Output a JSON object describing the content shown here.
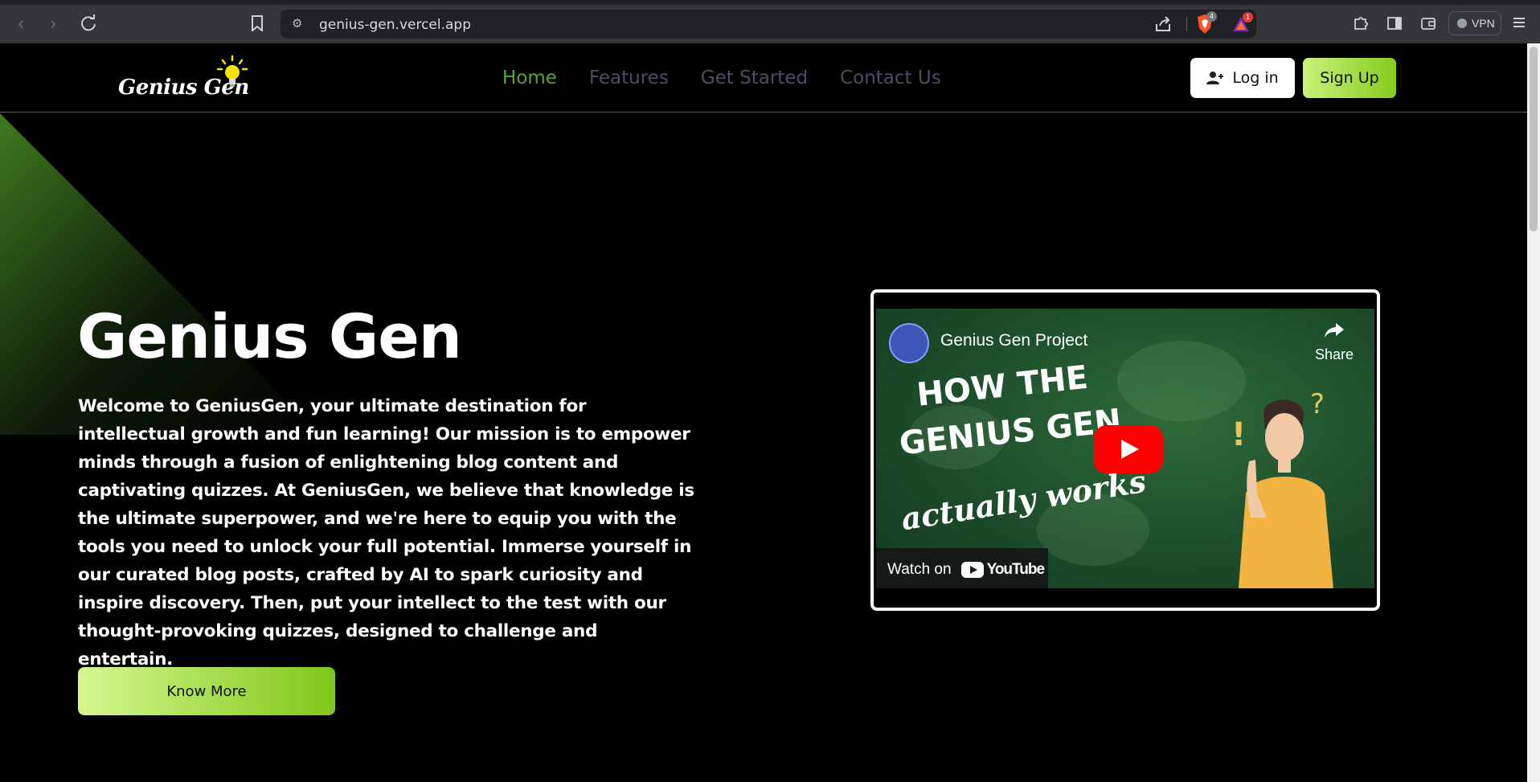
{
  "browser": {
    "url": "genius-gen.vercel.app",
    "brave_badge": "4",
    "alert_badge": "1",
    "vpn_label": "VPN"
  },
  "nav": {
    "logo_text": "Genius Gen",
    "links": [
      {
        "label": "Home",
        "active": true
      },
      {
        "label": "Features",
        "active": false
      },
      {
        "label": "Get Started",
        "active": false
      },
      {
        "label": "Contact Us",
        "active": false
      }
    ],
    "login_label": "Log in",
    "signup_label": "Sign Up"
  },
  "hero": {
    "title": "Genius Gen",
    "description": "Welcome to GeniusGen, your ultimate destination for intellectual growth and fun learning! Our mission is to empower minds through a fusion of enlightening blog content and captivating quizzes. At GeniusGen, we believe that knowledge is the ultimate superpower, and we're here to equip you with the tools you need to unlock your full potential. Immerse yourself in our curated blog posts, crafted by AI to spark curiosity and inspire discovery. Then, put your intellect to the test with our thought-provoking quizzes, designed to challenge and entertain.",
    "cta_label": "Know More"
  },
  "video": {
    "title": "Genius Gen Project",
    "share_label": "Share",
    "headline_line1": "HOW THE",
    "headline_line2": "GENIUS GEN",
    "cursive": "actually works",
    "watch_on": "Watch on",
    "youtube_label": "YouTube"
  },
  "colors": {
    "accent_green": "#5aa532",
    "button_gradient_start": "#d6f78e",
    "button_gradient_end": "#7fc71a",
    "nav_inactive": "#4a4f63",
    "youtube_red": "#ff0000"
  }
}
